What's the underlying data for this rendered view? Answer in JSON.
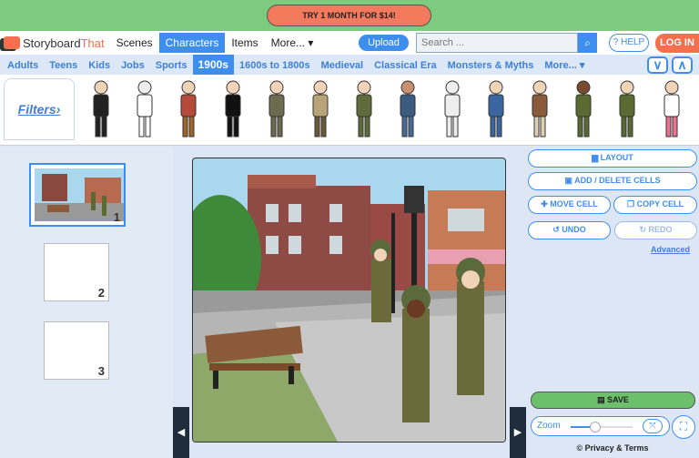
{
  "banner": {
    "promo": "TRY 1 MONTH FOR $14!"
  },
  "nav": {
    "logo_a": "Storyboard",
    "logo_b": "That",
    "items": [
      "Scenes",
      "Characters",
      "Items",
      "More... ▾"
    ],
    "active": "Characters",
    "upload": "Upload",
    "search_placeholder": "Search ...",
    "help": "? HELP",
    "login": "LOG IN"
  },
  "categories": {
    "items": [
      "Adults",
      "Teens",
      "Kids",
      "Jobs",
      "Sports",
      "1900s",
      "1600s to 1800s",
      "Medieval",
      "Classical Era",
      "Monsters & Myths",
      "More... ▾"
    ],
    "active": "1900s",
    "down": "∨",
    "up": "∧"
  },
  "strip": {
    "filters": "Filters›",
    "figures": [
      {
        "body": "#222",
        "legs": "#222",
        "skin": "#f1d3b8"
      },
      {
        "body": "#fff",
        "legs": "#fff",
        "skin": "#eee"
      },
      {
        "body": "#b34a3a",
        "legs": "#a0632a",
        "skin": "#f1d3b8"
      },
      {
        "body": "#111",
        "legs": "#111",
        "skin": "#f1d3b8"
      },
      {
        "body": "#6d6a50",
        "legs": "#6d6a50",
        "skin": "#f1d3b8"
      },
      {
        "body": "#b9a47a",
        "legs": "#6b5a3a",
        "skin": "#f1d3b8"
      },
      {
        "body": "#5f6b3a",
        "legs": "#5f6b3a",
        "skin": "#f1d3b8"
      },
      {
        "body": "#3a5a80",
        "legs": "#4a6a9a",
        "skin": "#c89070"
      },
      {
        "body": "#eee",
        "legs": "#eee",
        "skin": "#eee"
      },
      {
        "body": "#3a66a0",
        "legs": "#3a66a0",
        "skin": "#f1d3b8"
      },
      {
        "body": "#8a5a3a",
        "legs": "#e0d0b0",
        "skin": "#f1d3b8"
      },
      {
        "body": "#5a6a30",
        "legs": "#5a6a30",
        "skin": "#7a4a30"
      },
      {
        "body": "#5a6a30",
        "legs": "#5a6a30",
        "skin": "#f1d3b8"
      },
      {
        "body": "#fff",
        "legs": "#f07090",
        "skin": "#f1d3b8"
      }
    ]
  },
  "cells": [
    {
      "number": "1"
    },
    {
      "number": "2"
    },
    {
      "number": "3"
    }
  ],
  "stage": {
    "prev": "◀",
    "next": "▶"
  },
  "panel": {
    "layout": "▆ LAYOUT",
    "add_delete": "▣ ADD / DELETE CELLS",
    "move": "✚ MOVE CELL",
    "copy": "❐ COPY CELL",
    "undo": "↺ UNDO",
    "redo": "↻ REDO",
    "advanced": "Advanced",
    "save": "▤ SAVE",
    "zoom_label": "Zoom",
    "zoom_level": 0.4,
    "fit": "⤧",
    "fullscreen": "⛶",
    "privacy": "© Privacy & Terms"
  }
}
